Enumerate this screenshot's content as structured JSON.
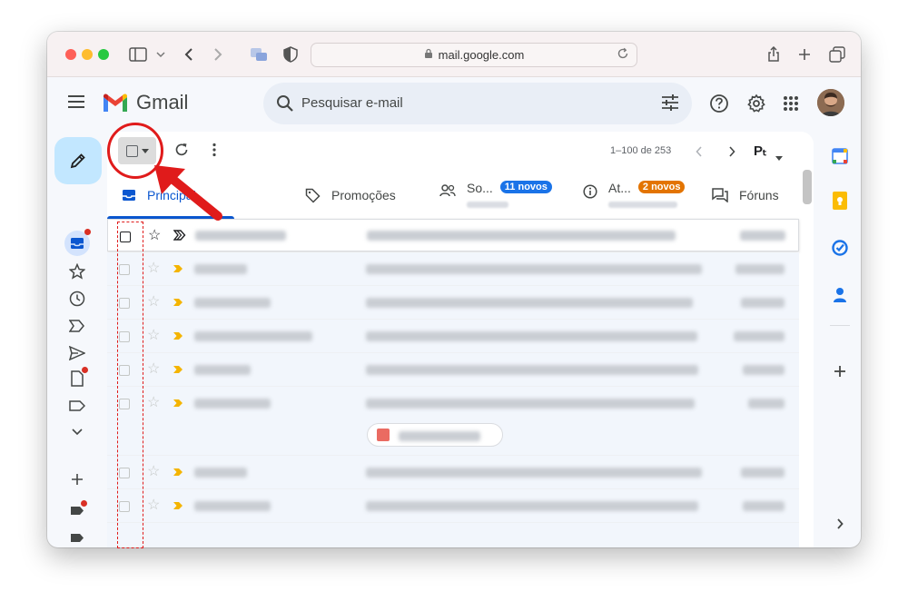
{
  "browser": {
    "url": "mail.google.com"
  },
  "app": {
    "name": "Gmail",
    "search_placeholder": "Pesquisar e-mail"
  },
  "toolbar": {
    "pagination": "1–100 de 253",
    "language": "Pₜ"
  },
  "tabs": [
    {
      "label": "Principal",
      "active": true
    },
    {
      "label": "Promoções"
    },
    {
      "label": "So...",
      "badge": "11 novos",
      "badge_color": "#1a73e8"
    },
    {
      "label": "At...",
      "badge": "2 novos",
      "badge_color": "#e37400"
    },
    {
      "label": "Fóruns"
    }
  ],
  "annotation_color": "#e01b1b",
  "icons": {
    "importance_first": "importance-outline",
    "importance_other": "importance-yellow"
  }
}
